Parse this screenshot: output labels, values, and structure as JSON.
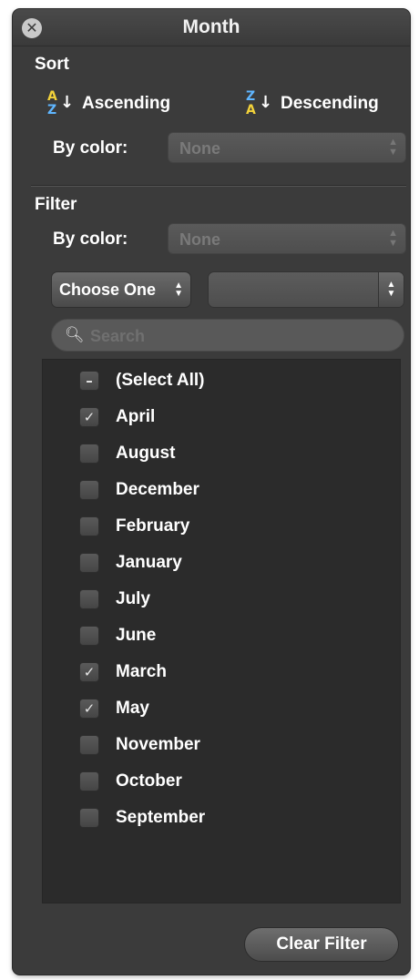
{
  "window": {
    "title": "Month",
    "close_icon": "close-icon",
    "close_glyph": "✕"
  },
  "sort": {
    "section_title": "Sort",
    "ascending_label": "Ascending",
    "descending_label": "Descending",
    "by_color_label": "By color:",
    "by_color_value": "None"
  },
  "filter": {
    "section_title": "Filter",
    "by_color_label": "By color:",
    "by_color_value": "None",
    "condition_select": "Choose One",
    "condition_value": ""
  },
  "search": {
    "placeholder": "Search",
    "value": ""
  },
  "items": [
    {
      "label": "(Select All)",
      "state": "mixed"
    },
    {
      "label": "April",
      "state": "checked"
    },
    {
      "label": "August",
      "state": "unchecked"
    },
    {
      "label": "December",
      "state": "unchecked"
    },
    {
      "label": "February",
      "state": "unchecked"
    },
    {
      "label": "January",
      "state": "unchecked"
    },
    {
      "label": "July",
      "state": "unchecked"
    },
    {
      "label": "June",
      "state": "unchecked"
    },
    {
      "label": "March",
      "state": "checked"
    },
    {
      "label": "May",
      "state": "checked"
    },
    {
      "label": "November",
      "state": "unchecked"
    },
    {
      "label": "October",
      "state": "unchecked"
    },
    {
      "label": "September",
      "state": "unchecked"
    }
  ],
  "footer": {
    "clear_filter_label": "Clear Filter"
  },
  "colors": {
    "panel_bg": "#3b3b3b",
    "list_bg": "#2b2b2b",
    "sort_icon_yellow": "#f2d23a",
    "sort_icon_blue": "#5fb6ff"
  }
}
